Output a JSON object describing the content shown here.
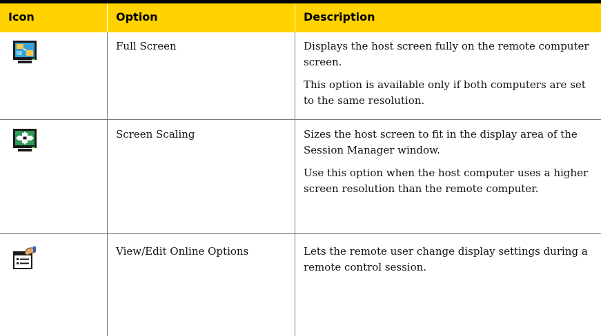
{
  "table": {
    "headers": {
      "icon": "Icon",
      "option": "Option",
      "description": "Description"
    },
    "rows": [
      {
        "icon": "full-screen-monitor-icon",
        "option": "Full Screen",
        "descriptions": [
          "Displays the host screen fully on the remote computer screen.",
          "This option is available only if both computers are set to the same resolution."
        ]
      },
      {
        "icon": "screen-scaling-monitor-icon",
        "option": "Screen Scaling",
        "descriptions": [
          "Sizes the host screen to fit in the display area of the Session Manager window.",
          "Use this option when the host computer uses a higher screen resolution than the remote computer."
        ]
      },
      {
        "icon": "online-options-clipboard-icon",
        "option": "View/Edit Online Options",
        "descriptions": [
          "Lets the remote user change display settings during a remote control session."
        ]
      }
    ]
  },
  "colors": {
    "header_background": "#ffd200",
    "rule": "#000000",
    "grid": "#7a7a7a"
  }
}
